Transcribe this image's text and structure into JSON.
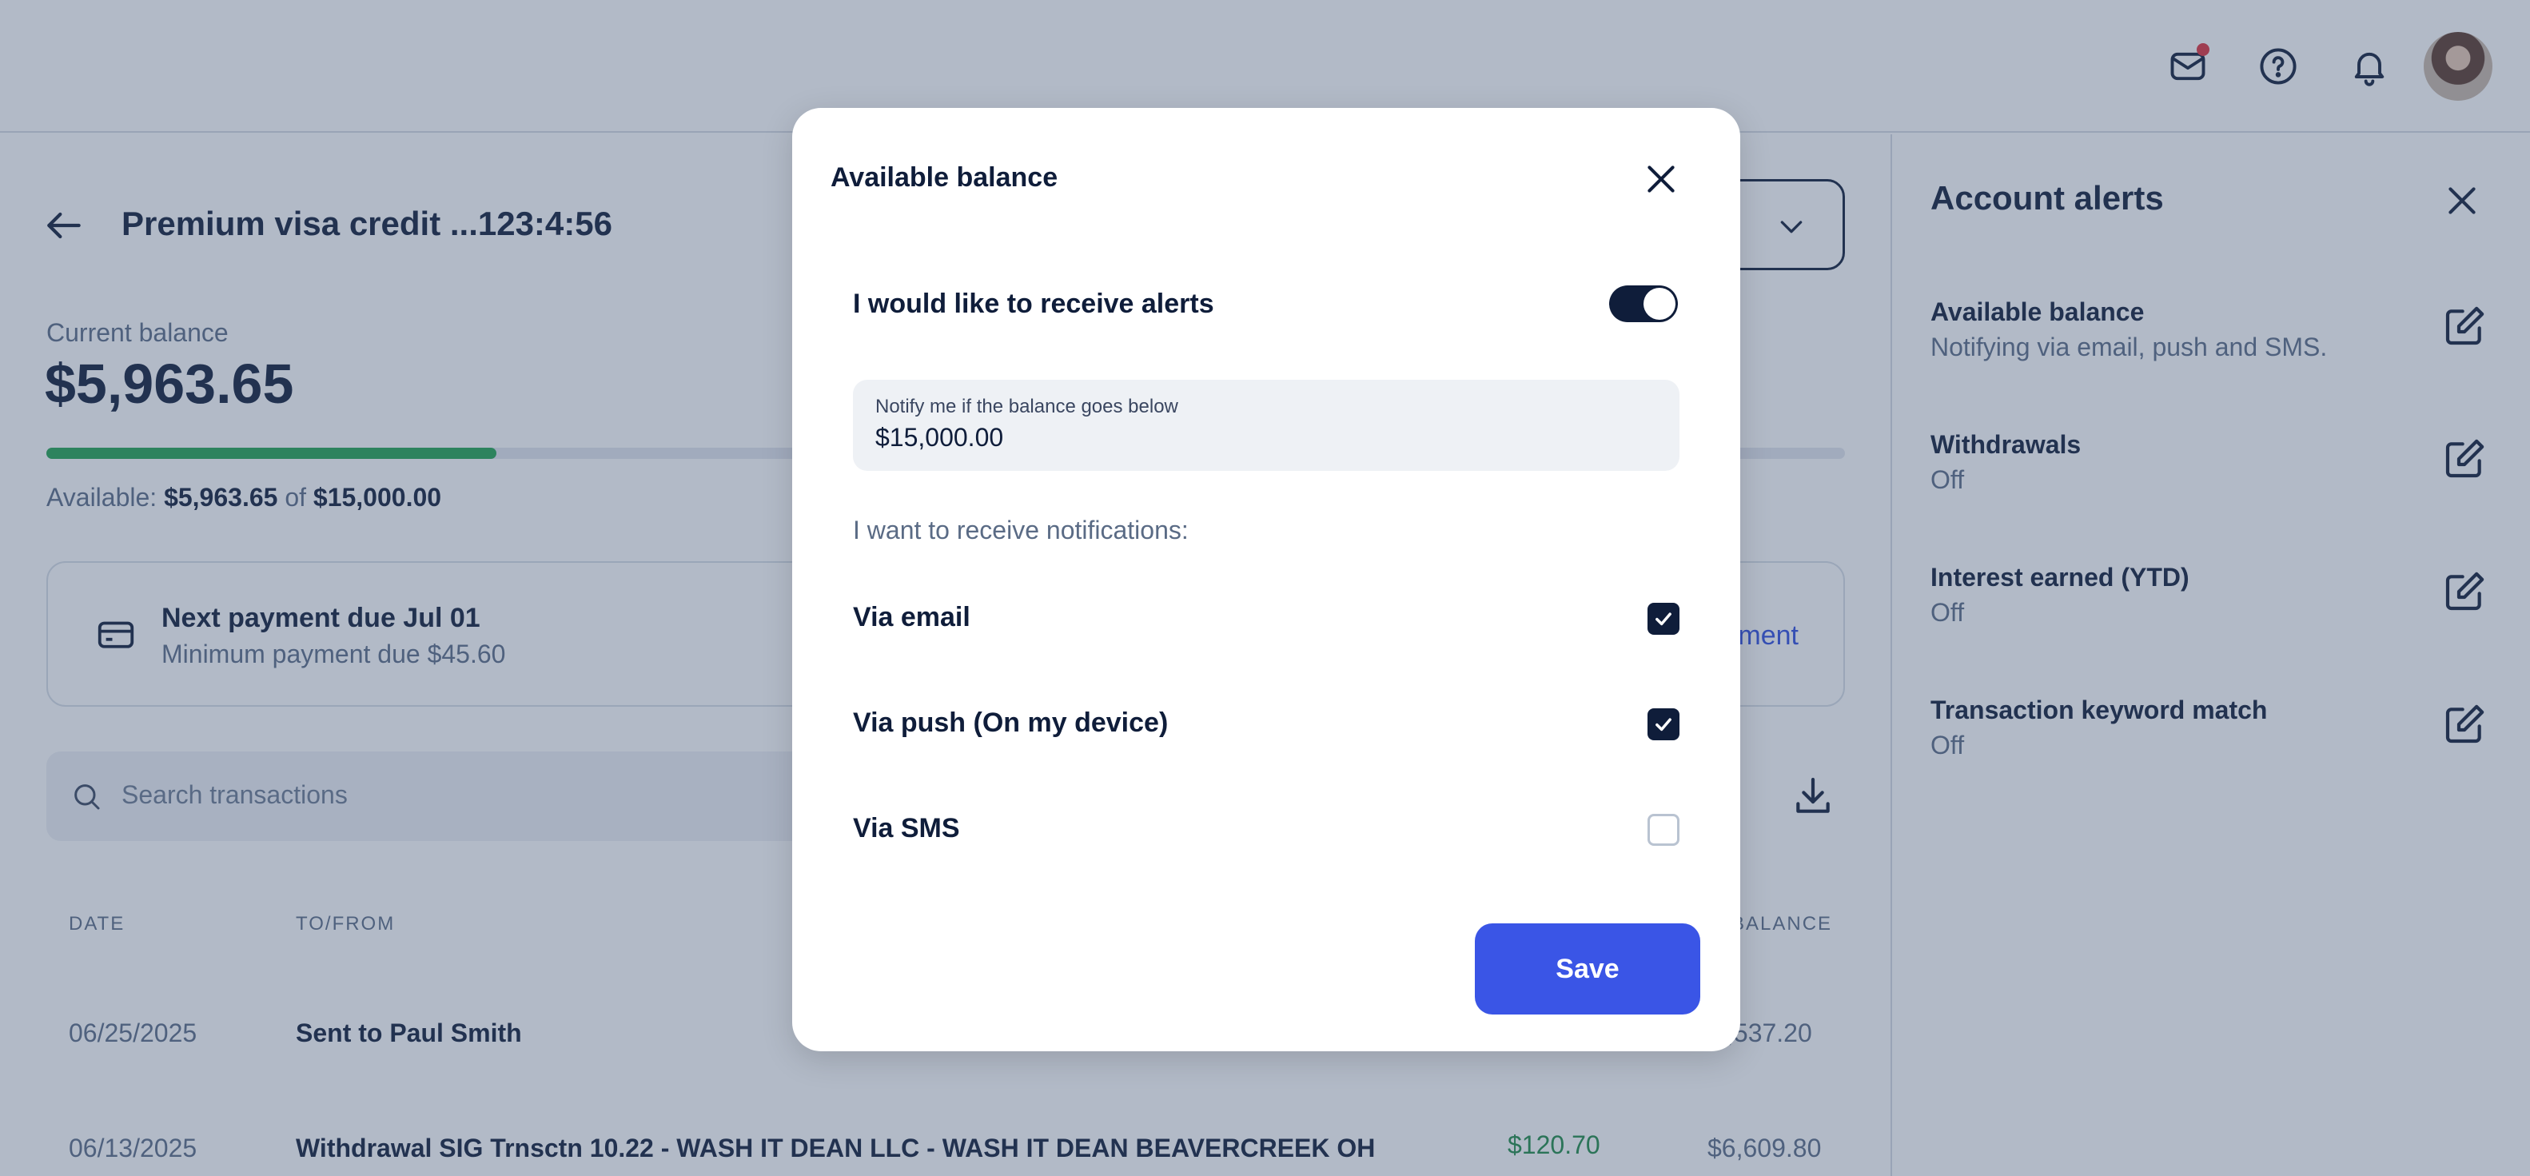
{
  "header": {
    "icons": [
      "mail-icon",
      "help-icon",
      "bell-icon"
    ],
    "mail_has_notification": true
  },
  "account": {
    "title": "Premium visa credit ...123:4:56",
    "balance_label": "Current balance",
    "balance_value": "$5,963.65",
    "progress_fraction": 0.25,
    "available_prefix": "Available:",
    "available_amount": "$5,963.65",
    "available_of": "of",
    "available_limit": "$15,000.00"
  },
  "payment": {
    "title": "Next payment due Jul 01",
    "subtitle": "Minimum payment due $45.60",
    "link_visible": "ment"
  },
  "search": {
    "placeholder": "Search transactions"
  },
  "table": {
    "headers": [
      "DATE",
      "TO/FROM",
      "BALANCE"
    ],
    "rows": [
      {
        "date": "06/25/2025",
        "name": "Sent to Paul Smith",
        "amount": "",
        "balance": ",537.20"
      },
      {
        "date": "06/13/2025",
        "name": "Withdrawal SIG Trnsctn 10.22 - WASH IT DEAN LLC - WASH IT DEAN BEAVERCREEK OH",
        "amount": "$120.70",
        "balance": "$6,609.80"
      }
    ]
  },
  "alerts_panel": {
    "title": "Account alerts",
    "items": [
      {
        "name": "Available balance",
        "desc": "Notifying via email, push and SMS."
      },
      {
        "name": "Withdrawals",
        "desc": "Off"
      },
      {
        "name": "Interest earned (YTD)",
        "desc": "Off"
      },
      {
        "name": "Transaction keyword match",
        "desc": "Off"
      }
    ]
  },
  "modal": {
    "title": "Available balance",
    "toggle_label": "I would like to receive alerts",
    "toggle_on": true,
    "threshold_label": "Notify me if the balance goes below",
    "threshold_value": "$15,000.00",
    "notifications_label": "I want to receive notifications:",
    "options": [
      {
        "label": "Via email",
        "checked": true
      },
      {
        "label": "Via push (On my device)",
        "checked": true
      },
      {
        "label": "Via SMS",
        "checked": false
      }
    ],
    "save_label": "Save"
  },
  "colors": {
    "brand_blue": "#3a55e6",
    "dark_navy": "#0f1d3a",
    "progress_green": "#22a351",
    "amount_green": "#1f8a47"
  }
}
